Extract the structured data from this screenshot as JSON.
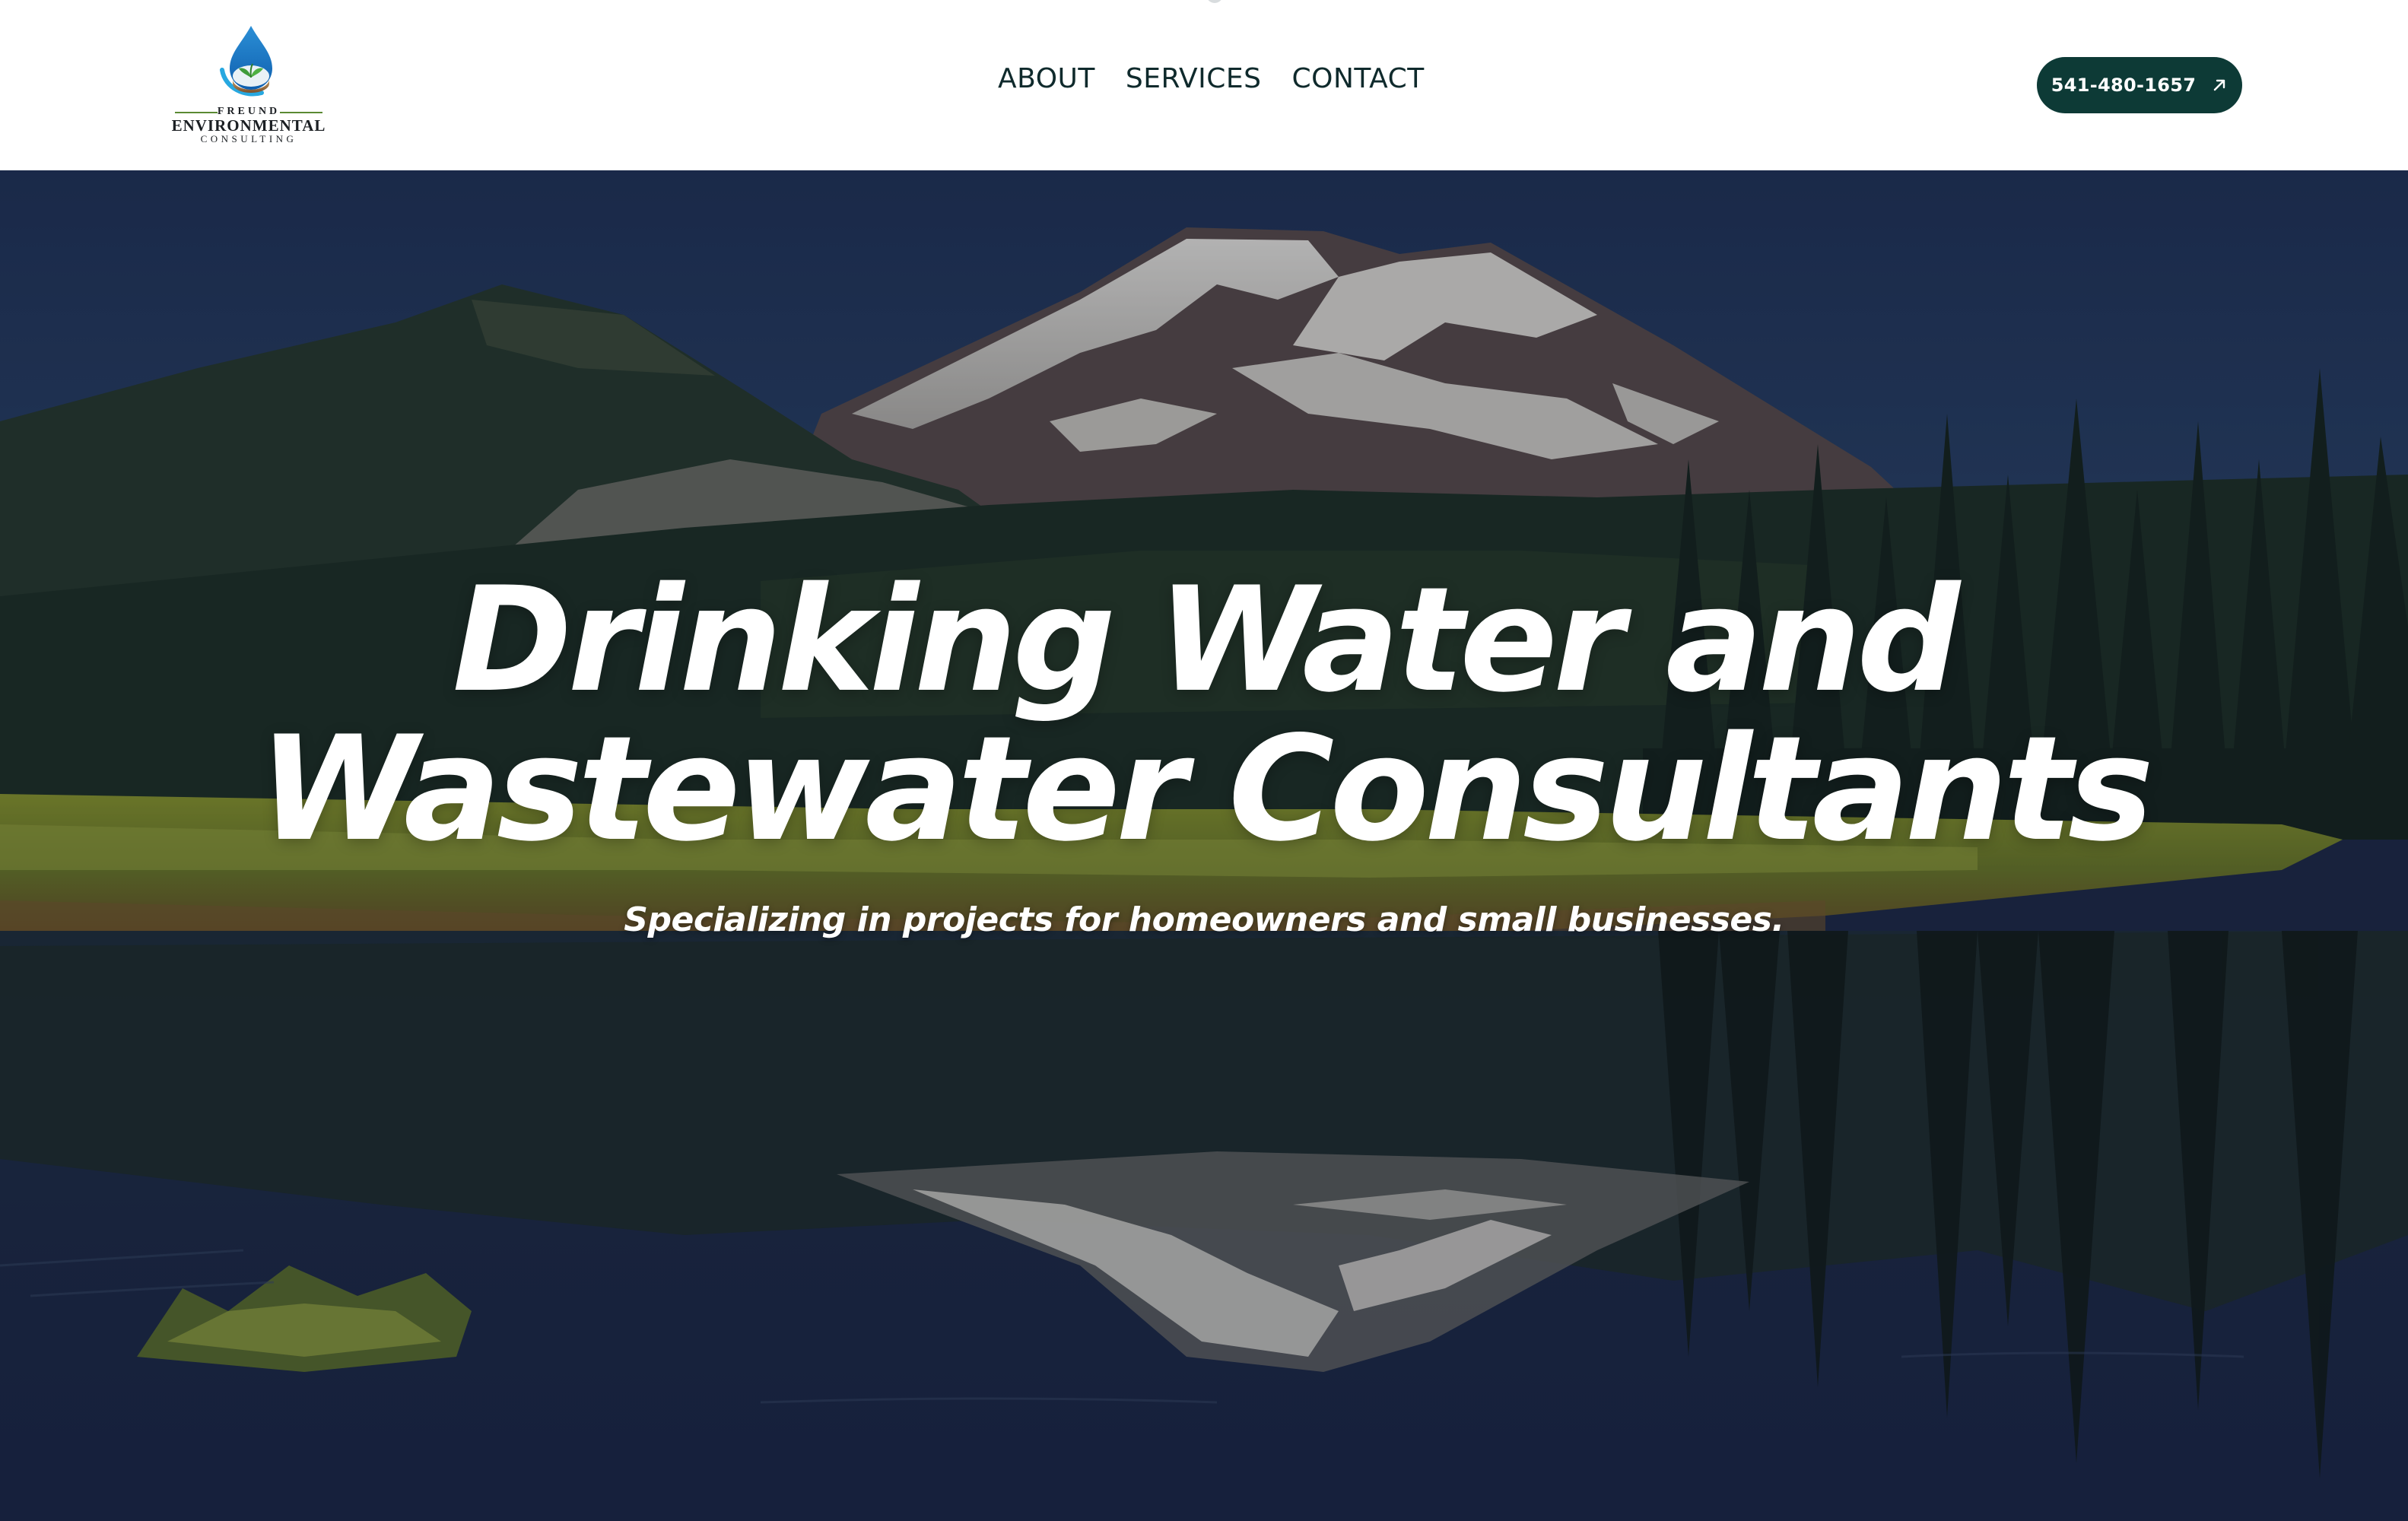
{
  "header": {
    "logo": {
      "line1": "FREUND",
      "line2": "ENVIRONMENTAL",
      "line3": "CONSULTING",
      "icon": "water-drop-logo-icon"
    },
    "nav": {
      "items": [
        {
          "label": "ABOUT"
        },
        {
          "label": "SERVICES"
        },
        {
          "label": "CONTACT"
        }
      ]
    },
    "phone_button": {
      "label": "541-480-1657",
      "icon": "arrow-up-right-icon"
    }
  },
  "hero": {
    "title_line1": "Drinking Water and",
    "title_line2": "Wastewater Consultants",
    "subtitle": "Specializing in projects for homeowners and small businesses."
  },
  "colors": {
    "header_bg": "#ffffff",
    "nav_text": "#0f2a2c",
    "button_bg": "#0d3a36",
    "button_text": "#ffffff",
    "hero_text": "#ffffff"
  }
}
